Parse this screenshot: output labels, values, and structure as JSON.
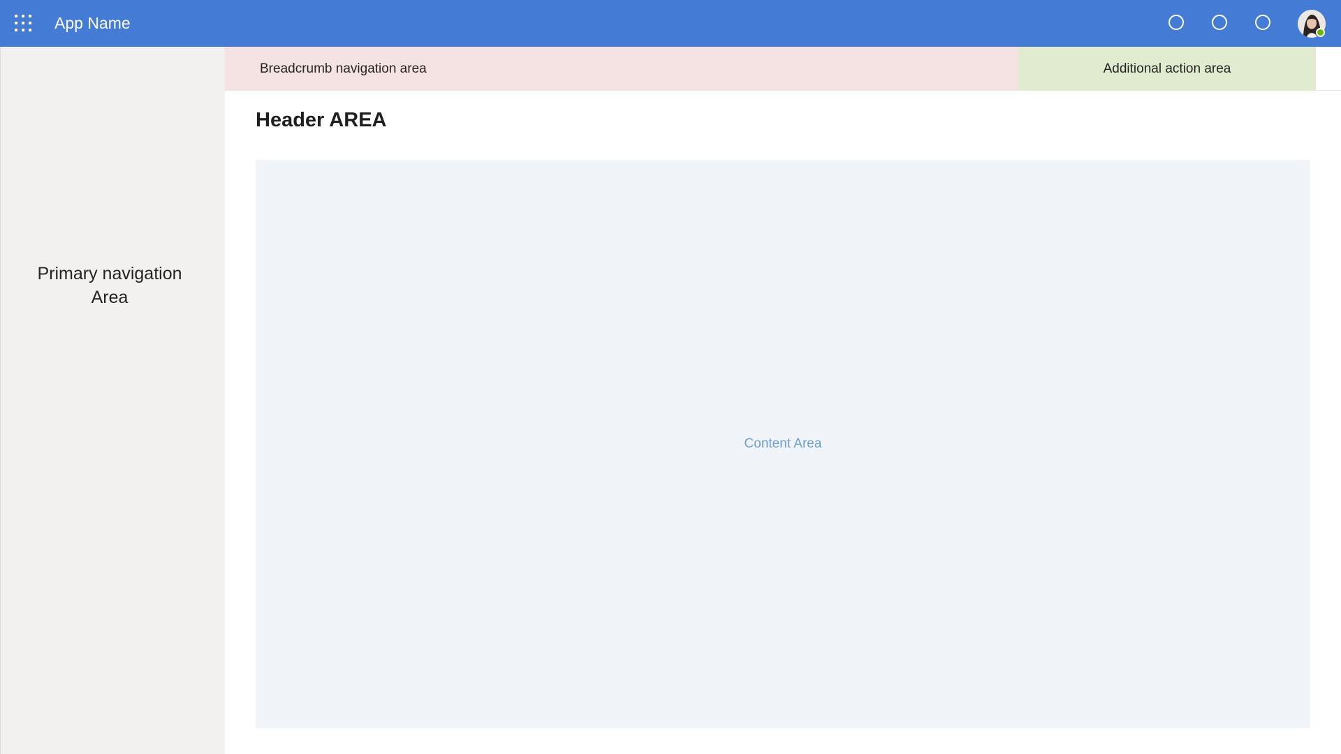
{
  "app": {
    "name": "App Name",
    "brand_color": "#447bd4"
  },
  "topbar": {
    "waffle_icon": "app-launcher-icon",
    "action_icons": [
      "circle-icon",
      "circle-icon",
      "circle-icon"
    ],
    "avatar_presence": "available",
    "presence_color": "#6bb700"
  },
  "sidebar": {
    "label": "Primary navigation\nArea"
  },
  "breadcrumb": {
    "label": "Breadcrumb navigation area",
    "color": "#f5e2e2"
  },
  "actions": {
    "label": "Additional action area",
    "color": "#e0ebcf"
  },
  "header": {
    "title": "Header AREA"
  },
  "content": {
    "label": "Content Area",
    "color": "#f0f4f9"
  }
}
